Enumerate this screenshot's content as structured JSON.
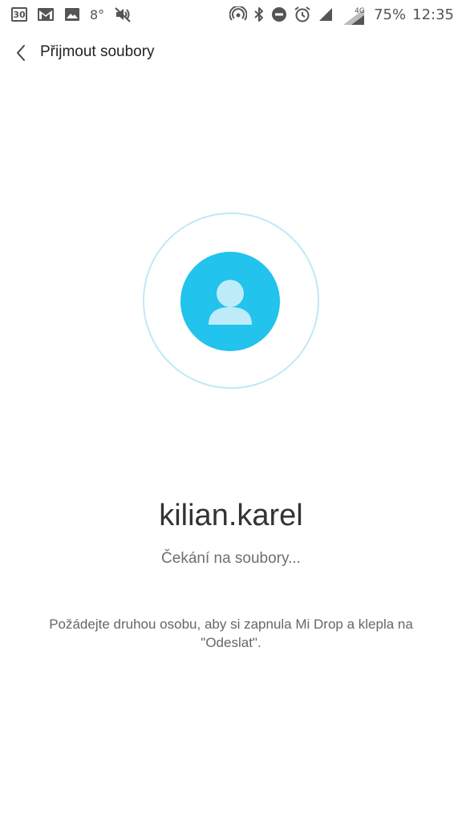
{
  "status_bar": {
    "calendar_day": "30",
    "temperature": "8°",
    "network_type": "4G",
    "battery": "75%",
    "time": "12:35",
    "icons_left": [
      "calendar-icon",
      "gmail-icon",
      "gallery-icon",
      "weather-temperature",
      "volume-muted-icon"
    ],
    "icons_right": [
      "hotspot-icon",
      "bluetooth-icon",
      "do-not-disturb-icon",
      "alarm-icon",
      "signal-icon",
      "signal-4g-icon"
    ]
  },
  "header": {
    "back_icon": "chevron-left-icon",
    "title": "Přijmout soubory"
  },
  "receiver": {
    "avatar_icon": "person-icon",
    "device_name": "kilian.karel",
    "status": "Čekání na soubory...",
    "hint": "Požádejte druhou osobu, aby si zapnula Mi Drop a klepla na \"Odeslat\"."
  },
  "colors": {
    "accent": "#22c3ec",
    "ring": "#bfe9f5",
    "avatar_figure": "#bdecf8"
  }
}
